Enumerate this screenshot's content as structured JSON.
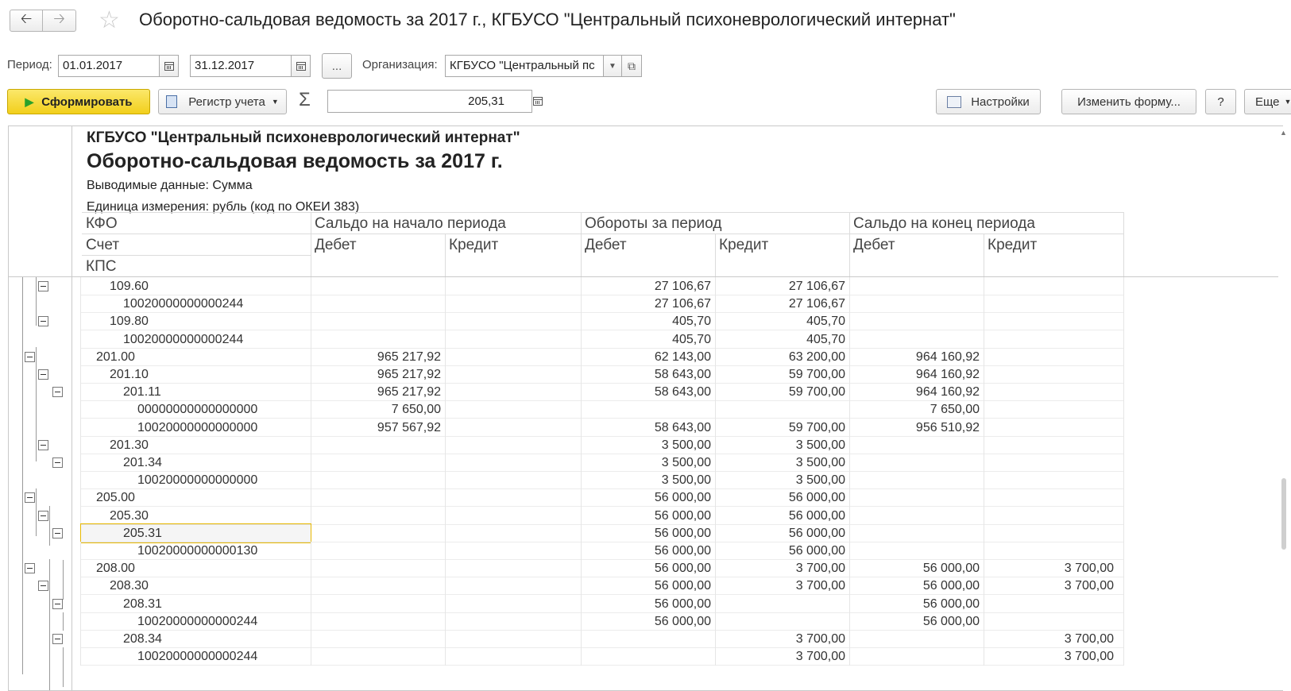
{
  "window": {
    "title": "Оборотно-сальдовая ведомость за 2017 г., КГБУСО \"Центральный психоневрологический интернат\"",
    "back_icon": "arrow-left",
    "forward_icon": "arrow-right",
    "favorite_icon": "star"
  },
  "filters": {
    "period_label": "Период:",
    "date_from": "01.01.2017",
    "date_to": "31.12.2017",
    "ellipsis": "...",
    "org_label": "Организация:",
    "org_value": "КГБУСО \"Центральный пс"
  },
  "toolbar": {
    "generate_label": "Сформировать",
    "register_label": "Регистр учета",
    "sigma": "Σ",
    "sum_value": "205,31",
    "settings_label": "Настройки",
    "change_form_label": "Изменить форму...",
    "help_label": "?",
    "more_label": "Еще"
  },
  "report": {
    "org_name": "КГБУСО \"Центральный психоневрологический интернат\"",
    "title": "Оборотно-сальдовая ведомость за 2017 г.",
    "shown_data": "Выводимые данные:   Сумма",
    "unit": "Единица измерения: рубль (код по ОКЕИ 383)",
    "headers": {
      "kfo": "КФО",
      "account": "Счет",
      "kps": "КПС",
      "opening": "Сальдо на начало периода",
      "turnover": "Обороты за период",
      "closing": "Сальдо на конец периода",
      "debit": "Дебет",
      "credit": "Кредит"
    },
    "rows": [
      {
        "name": "109.60",
        "level": 2,
        "toggle": true,
        "values": [
          "",
          "",
          "27 106,67",
          "27 106,67",
          "",
          ""
        ]
      },
      {
        "name": "10020000000000244",
        "level": 3,
        "toggle": false,
        "values": [
          "",
          "",
          "27 106,67",
          "27 106,67",
          "",
          ""
        ]
      },
      {
        "name": "109.80",
        "level": 2,
        "toggle": true,
        "values": [
          "",
          "",
          "405,70",
          "405,70",
          "",
          ""
        ]
      },
      {
        "name": "10020000000000244",
        "level": 3,
        "toggle": false,
        "values": [
          "",
          "",
          "405,70",
          "405,70",
          "",
          ""
        ]
      },
      {
        "name": "201.00",
        "level": 1,
        "toggle": true,
        "values": [
          "965 217,92",
          "",
          "62 143,00",
          "63 200,00",
          "964 160,92",
          ""
        ]
      },
      {
        "name": "201.10",
        "level": 2,
        "toggle": true,
        "values": [
          "965 217,92",
          "",
          "58 643,00",
          "59 700,00",
          "964 160,92",
          ""
        ]
      },
      {
        "name": "201.11",
        "level": 3,
        "toggle": true,
        "values": [
          "965 217,92",
          "",
          "58 643,00",
          "59 700,00",
          "964 160,92",
          ""
        ]
      },
      {
        "name": "00000000000000000",
        "level": 4,
        "toggle": false,
        "values": [
          "7 650,00",
          "",
          "",
          "",
          "7 650,00",
          ""
        ]
      },
      {
        "name": "10020000000000000",
        "level": 4,
        "toggle": false,
        "values": [
          "957 567,92",
          "",
          "58 643,00",
          "59 700,00",
          "956 510,92",
          ""
        ]
      },
      {
        "name": "201.30",
        "level": 2,
        "toggle": true,
        "values": [
          "",
          "",
          "3 500,00",
          "3 500,00",
          "",
          ""
        ]
      },
      {
        "name": "201.34",
        "level": 3,
        "toggle": true,
        "values": [
          "",
          "",
          "3 500,00",
          "3 500,00",
          "",
          ""
        ]
      },
      {
        "name": "10020000000000000",
        "level": 4,
        "toggle": false,
        "values": [
          "",
          "",
          "3 500,00",
          "3 500,00",
          "",
          ""
        ]
      },
      {
        "name": "205.00",
        "level": 1,
        "toggle": true,
        "values": [
          "",
          "",
          "56 000,00",
          "56 000,00",
          "",
          ""
        ]
      },
      {
        "name": "205.30",
        "level": 2,
        "toggle": true,
        "values": [
          "",
          "",
          "56 000,00",
          "56 000,00",
          "",
          ""
        ]
      },
      {
        "name": "205.31",
        "level": 3,
        "toggle": true,
        "selected": true,
        "values": [
          "",
          "",
          "56 000,00",
          "56 000,00",
          "",
          ""
        ]
      },
      {
        "name": "10020000000000130",
        "level": 4,
        "toggle": false,
        "values": [
          "",
          "",
          "56 000,00",
          "56 000,00",
          "",
          ""
        ]
      },
      {
        "name": "208.00",
        "level": 1,
        "toggle": true,
        "values": [
          "",
          "",
          "56 000,00",
          "3 700,00",
          "56 000,00",
          "3 700,00"
        ]
      },
      {
        "name": "208.30",
        "level": 2,
        "toggle": true,
        "values": [
          "",
          "",
          "56 000,00",
          "3 700,00",
          "56 000,00",
          "3 700,00"
        ]
      },
      {
        "name": "208.31",
        "level": 3,
        "toggle": true,
        "values": [
          "",
          "",
          "56 000,00",
          "",
          "56 000,00",
          ""
        ]
      },
      {
        "name": "10020000000000244",
        "level": 4,
        "toggle": false,
        "values": [
          "",
          "",
          "56 000,00",
          "",
          "56 000,00",
          ""
        ]
      },
      {
        "name": "208.34",
        "level": 3,
        "toggle": true,
        "values": [
          "",
          "",
          "",
          "3 700,00",
          "",
          "3 700,00"
        ]
      },
      {
        "name": "10020000000000244",
        "level": 4,
        "toggle": false,
        "values": [
          "",
          "",
          "",
          "3 700,00",
          "",
          "3 700,00"
        ]
      }
    ]
  },
  "colors": {
    "generate_button": "#f2cf1c",
    "selected_cell_border": "#e8b800",
    "grid": "#dcdcdc"
  }
}
